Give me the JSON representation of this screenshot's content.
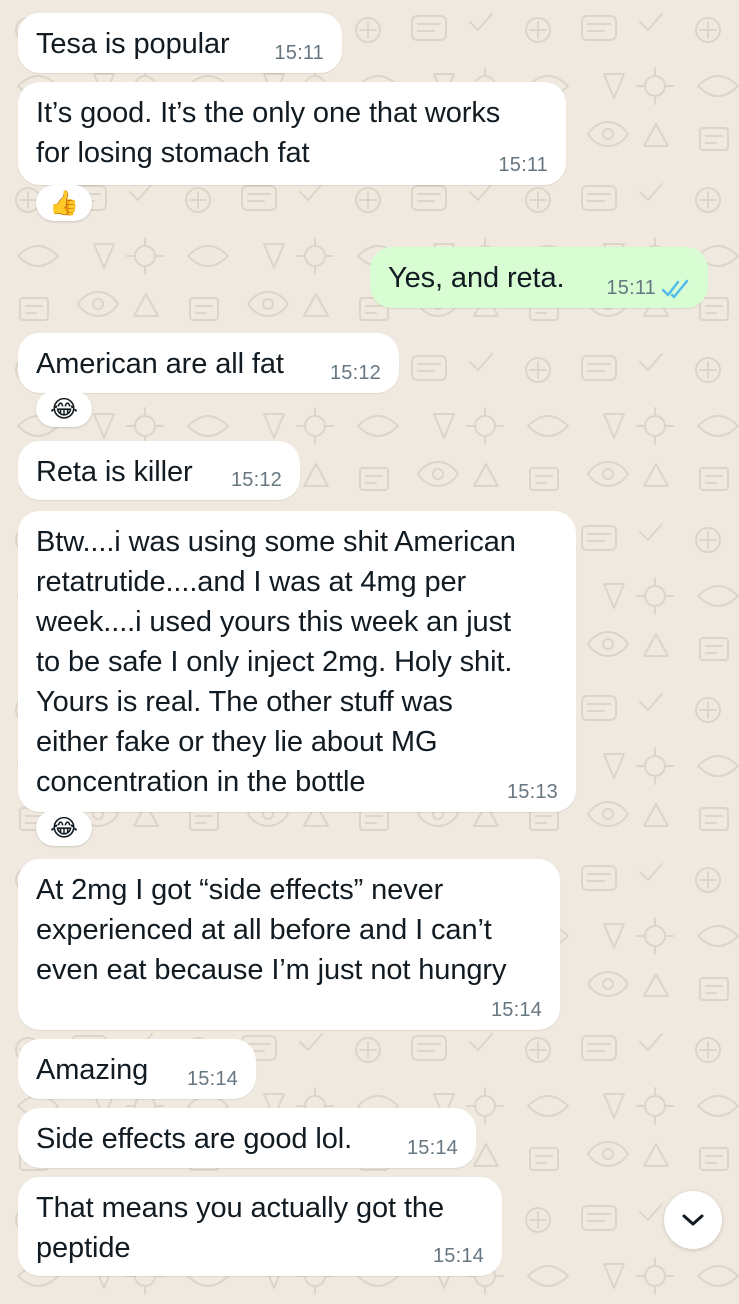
{
  "chat": {
    "messages": [
      {
        "direction": "incoming",
        "text": "Tesa is popular",
        "time": "15:11"
      },
      {
        "direction": "incoming",
        "text": "It’s good. It’s the only one that works\nfor losing stomach fat",
        "time": "15:11",
        "reaction": "thumbs-up-icon"
      },
      {
        "direction": "outgoing",
        "text": "Yes, and reta.",
        "time": "15:11",
        "status": "read"
      },
      {
        "direction": "incoming",
        "text": "American are all fat",
        "time": "15:12",
        "reaction": "tears-of-joy-icon"
      },
      {
        "direction": "incoming",
        "text": "Reta is killer",
        "time": "15:12"
      },
      {
        "direction": "incoming",
        "text": "Btw....i was using some shit American\nretatrutide....and I was at 4mg per\nweek....i used yours this week an just\nto be safe I only inject 2mg. Holy shit.\nYours is real. The other stuff was\neither fake or they lie about MG\nconcentration in the bottle",
        "time": "15:13",
        "reaction": "tears-of-joy-icon"
      },
      {
        "direction": "incoming",
        "text": "At 2mg I got “side effects” never\nexperienced at all before and I can’t\neven eat because I’m just not hungry",
        "time": "15:14"
      },
      {
        "direction": "incoming",
        "text": "Amazing",
        "time": "15:14"
      },
      {
        "direction": "incoming",
        "text": "Side effects are good lol.",
        "time": "15:14"
      },
      {
        "direction": "incoming",
        "text": "That means you actually got the\npeptide",
        "time": "15:14"
      }
    ]
  },
  "ui": {
    "scroll_down_icon": "chevron-down-icon",
    "read_receipt_icon": "double-check-icon",
    "colors": {
      "background": "#efe9df",
      "incoming_bubble": "#ffffff",
      "outgoing_bubble": "#d9fdd3",
      "timestamp": "#667781",
      "read_receipt": "#53bdeb"
    }
  }
}
